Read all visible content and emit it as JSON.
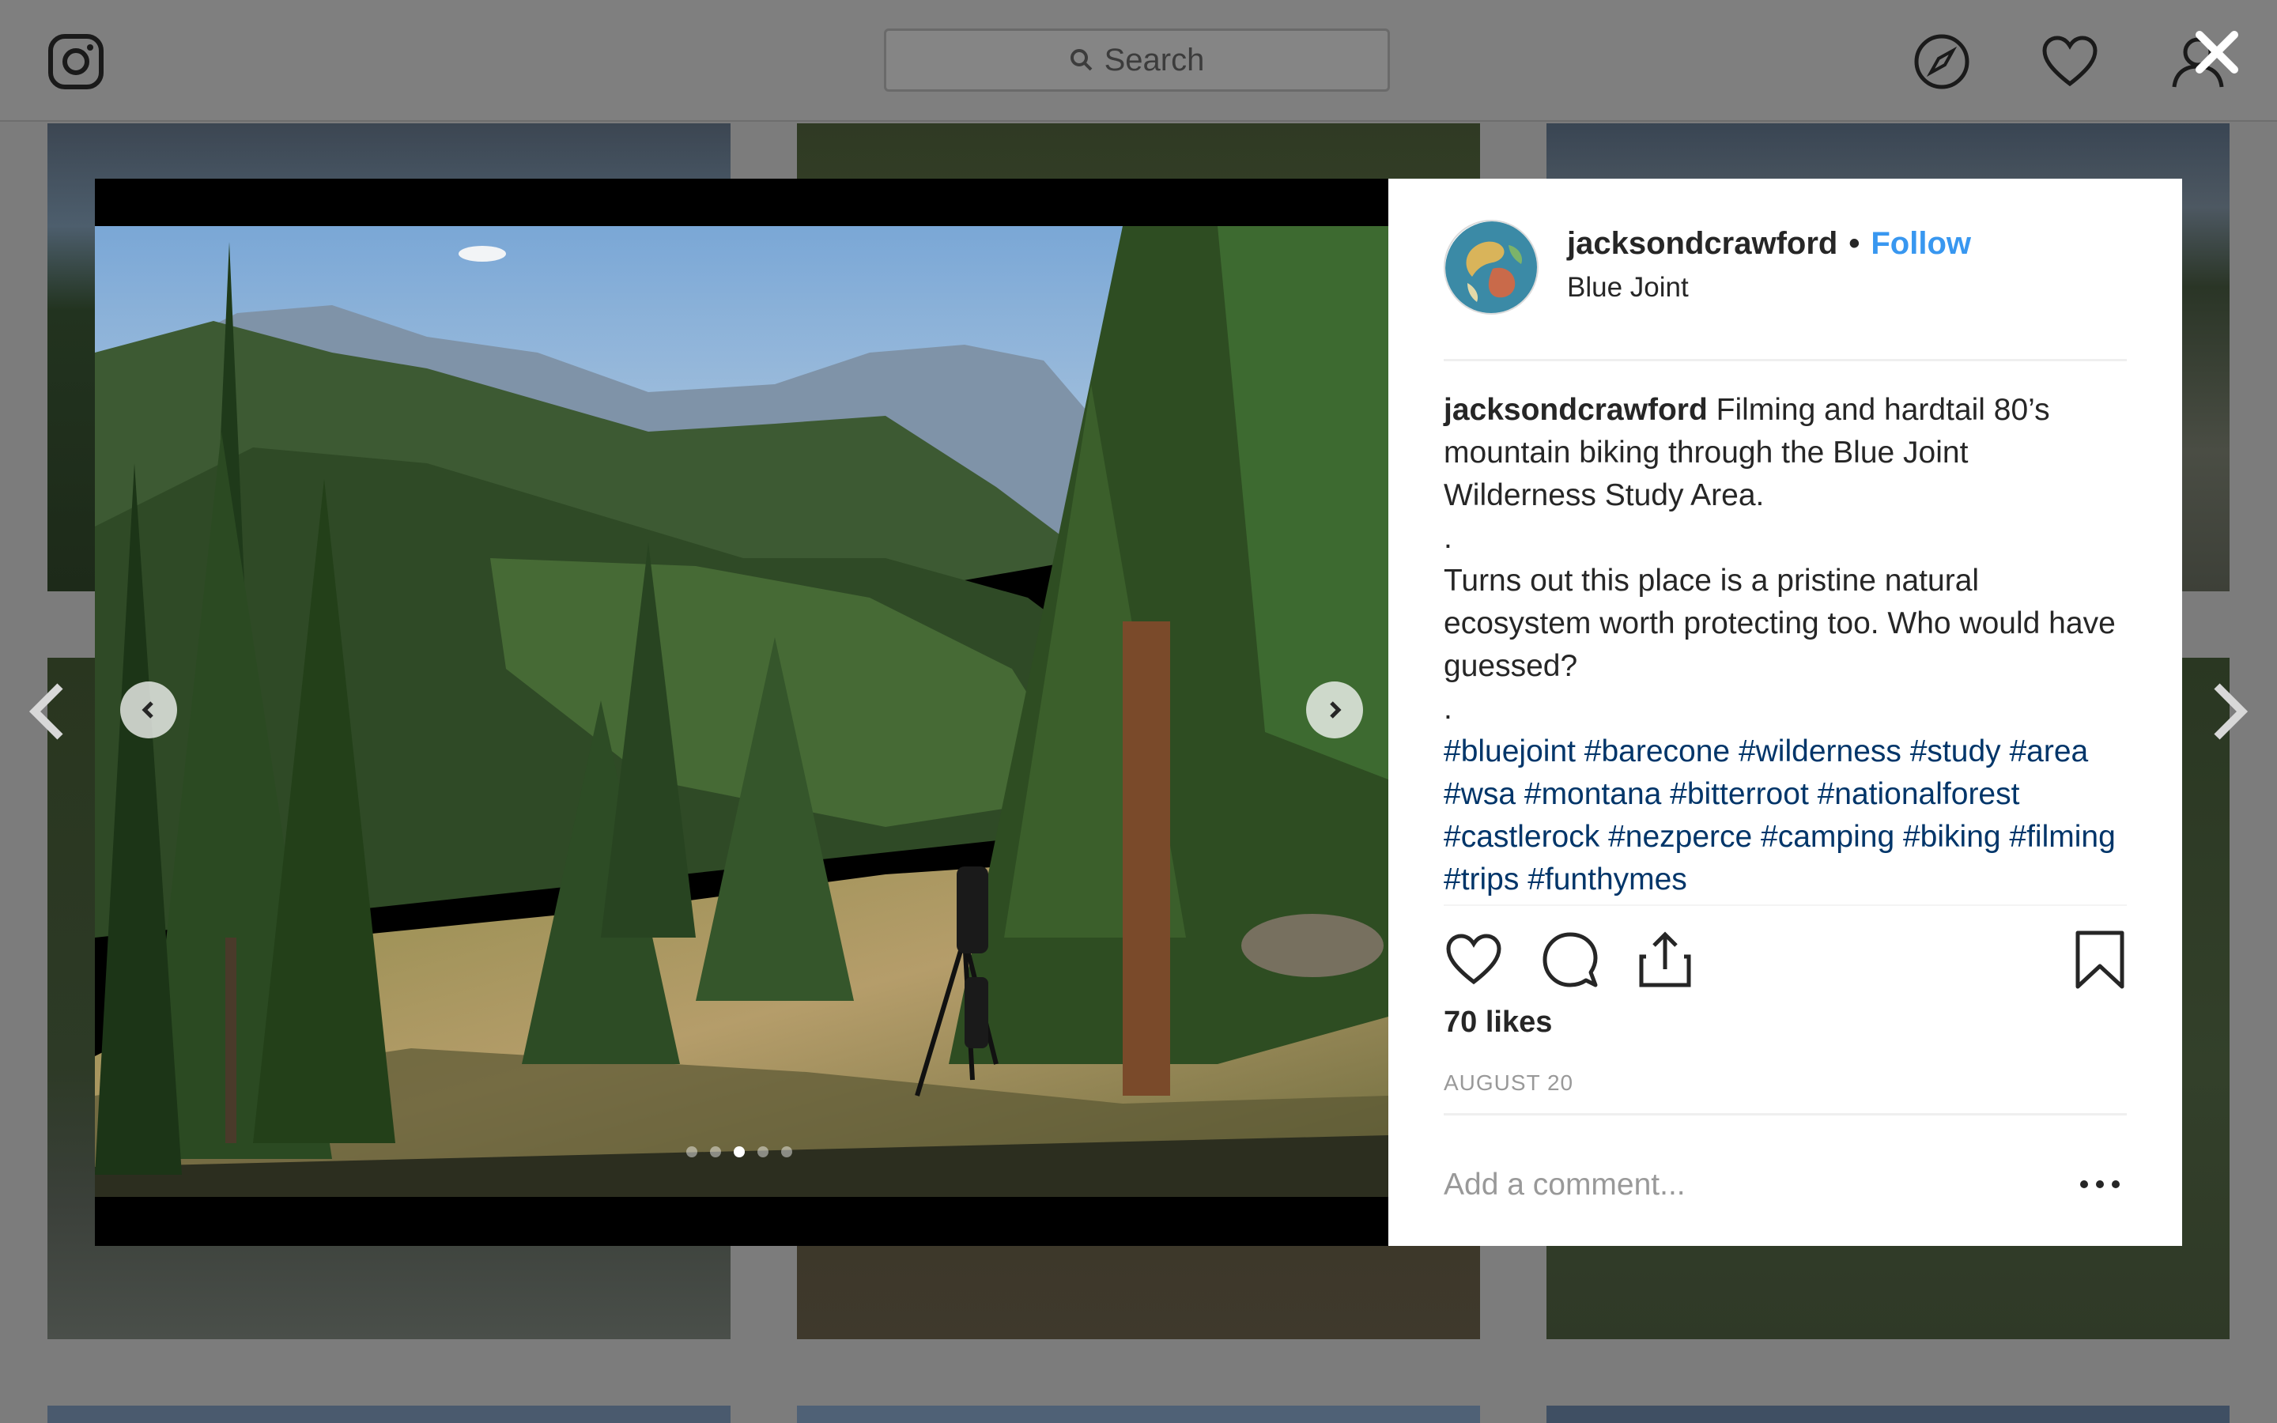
{
  "nav": {
    "search_placeholder": "Search",
    "icons": [
      "instagram-logo-icon",
      "compass-icon",
      "heart-icon",
      "profile-icon"
    ]
  },
  "overlay": {
    "close_icon": "close-icon",
    "prev_icon": "chevron-left-icon",
    "next_icon": "chevron-right-icon"
  },
  "post": {
    "username": "jacksondcrawford",
    "separator": "•",
    "follow_label": "Follow",
    "location": "Blue Joint",
    "caption_author": "jacksondcrawford",
    "caption_text_1": "Filming and hardtail 80’s mountain biking through the Blue Joint Wilderness Study Area.",
    "caption_dot_1": ".",
    "caption_text_2": "Turns out this place is a pristine natural ecosystem worth protecting too. Who would have guessed?",
    "caption_dot_2": ".",
    "hashtags": "#bluejoint #barecone #wilderness #study #area #wsa #montana #bitterroot #nationalforest #castlerock #nezperce #camping #biking #filming #trips #funthymes",
    "likes": "70 likes",
    "date": "AUGUST 20",
    "comment_placeholder": "Add a comment...",
    "carousel": {
      "slides": 5,
      "active_slide": 3
    }
  },
  "colors": {
    "link_blue": "#3897f0",
    "hashtag_blue": "#003569",
    "text": "#262626",
    "muted": "#999999",
    "overlay_bg": "#7c7c7c"
  }
}
